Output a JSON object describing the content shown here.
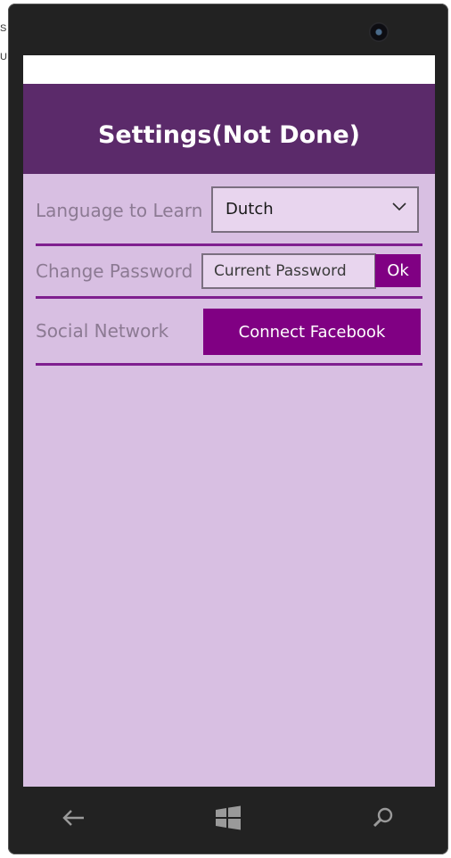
{
  "background_window": {
    "side_letters": [
      "S",
      "U"
    ]
  },
  "app": {
    "title": "Settings(Not Done)",
    "colors": {
      "header": "#5b2a6a",
      "content_bg": "#d8bfe2",
      "accent": "#800083",
      "label": "#8c7a93"
    }
  },
  "settings": {
    "language": {
      "label": "Language to Learn",
      "selected": "Dutch",
      "icon": "chevron-down-icon"
    },
    "password": {
      "label": "Change Password",
      "placeholder": "Current Password",
      "value": "",
      "ok_label": "Ok"
    },
    "social": {
      "label": "Social Network",
      "button_label": "Connect Facebook"
    }
  },
  "nav": {
    "back_icon": "back-arrow-icon",
    "home_icon": "windows-logo-icon",
    "search_icon": "search-icon"
  }
}
